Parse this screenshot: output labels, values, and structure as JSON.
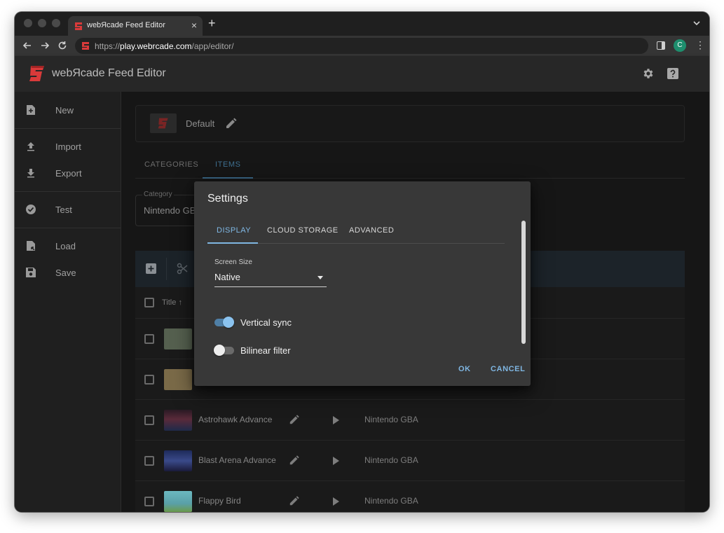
{
  "browser": {
    "tab_title": "webЯcade Feed Editor",
    "tab_close": "×",
    "new_tab": "+",
    "url_scheme": "https://",
    "url_host": "play.webrcade.com",
    "url_path": "/app/editor/",
    "profile_initial": "C",
    "menu_glyph": "⋮"
  },
  "app": {
    "title": "webЯcade Feed Editor"
  },
  "drawer": {
    "items": [
      {
        "label": "New",
        "icon": "new-file-icon"
      },
      {
        "label": "Import",
        "icon": "upload-icon"
      },
      {
        "label": "Export",
        "icon": "download-icon"
      },
      {
        "label": "Test",
        "icon": "check-circle-icon"
      },
      {
        "label": "Load",
        "icon": "file-open-icon"
      },
      {
        "label": "Save",
        "icon": "floppy-icon"
      }
    ]
  },
  "feed": {
    "name": "Default"
  },
  "main_tabs": [
    "CATEGORIES",
    "ITEMS"
  ],
  "category": {
    "label": "Category",
    "value": "Nintendo GBA"
  },
  "table": {
    "header_title": "Title",
    "sort_glyph": "↑",
    "rows": [
      {
        "name": "",
        "category": "",
        "thumb_color": "#55604f"
      },
      {
        "name": "",
        "category": "",
        "thumb_color": "#7a6a48"
      },
      {
        "name": "Astrohawk Advance",
        "category": "Nintendo GBA",
        "thumb_color": "#3a2630"
      },
      {
        "name": "Blast Arena Advance",
        "category": "Nintendo GBA",
        "thumb_color": "#2a3a6a"
      },
      {
        "name": "Flappy Bird",
        "category": "Nintendo GBA",
        "thumb_color": "#5aa0a8"
      }
    ]
  },
  "dialog": {
    "title": "Settings",
    "tabs": [
      "DISPLAY",
      "CLOUD STORAGE",
      "ADVANCED"
    ],
    "screen_size": {
      "label": "Screen Size",
      "value": "Native"
    },
    "switches": [
      {
        "label": "Vertical sync",
        "on": true
      },
      {
        "label": "Bilinear filter",
        "on": false
      }
    ],
    "ok_label": "OK",
    "cancel_label": "CANCEL"
  },
  "colors": {
    "accent": "#80b9e6",
    "brand_red": "#d93a3a"
  }
}
